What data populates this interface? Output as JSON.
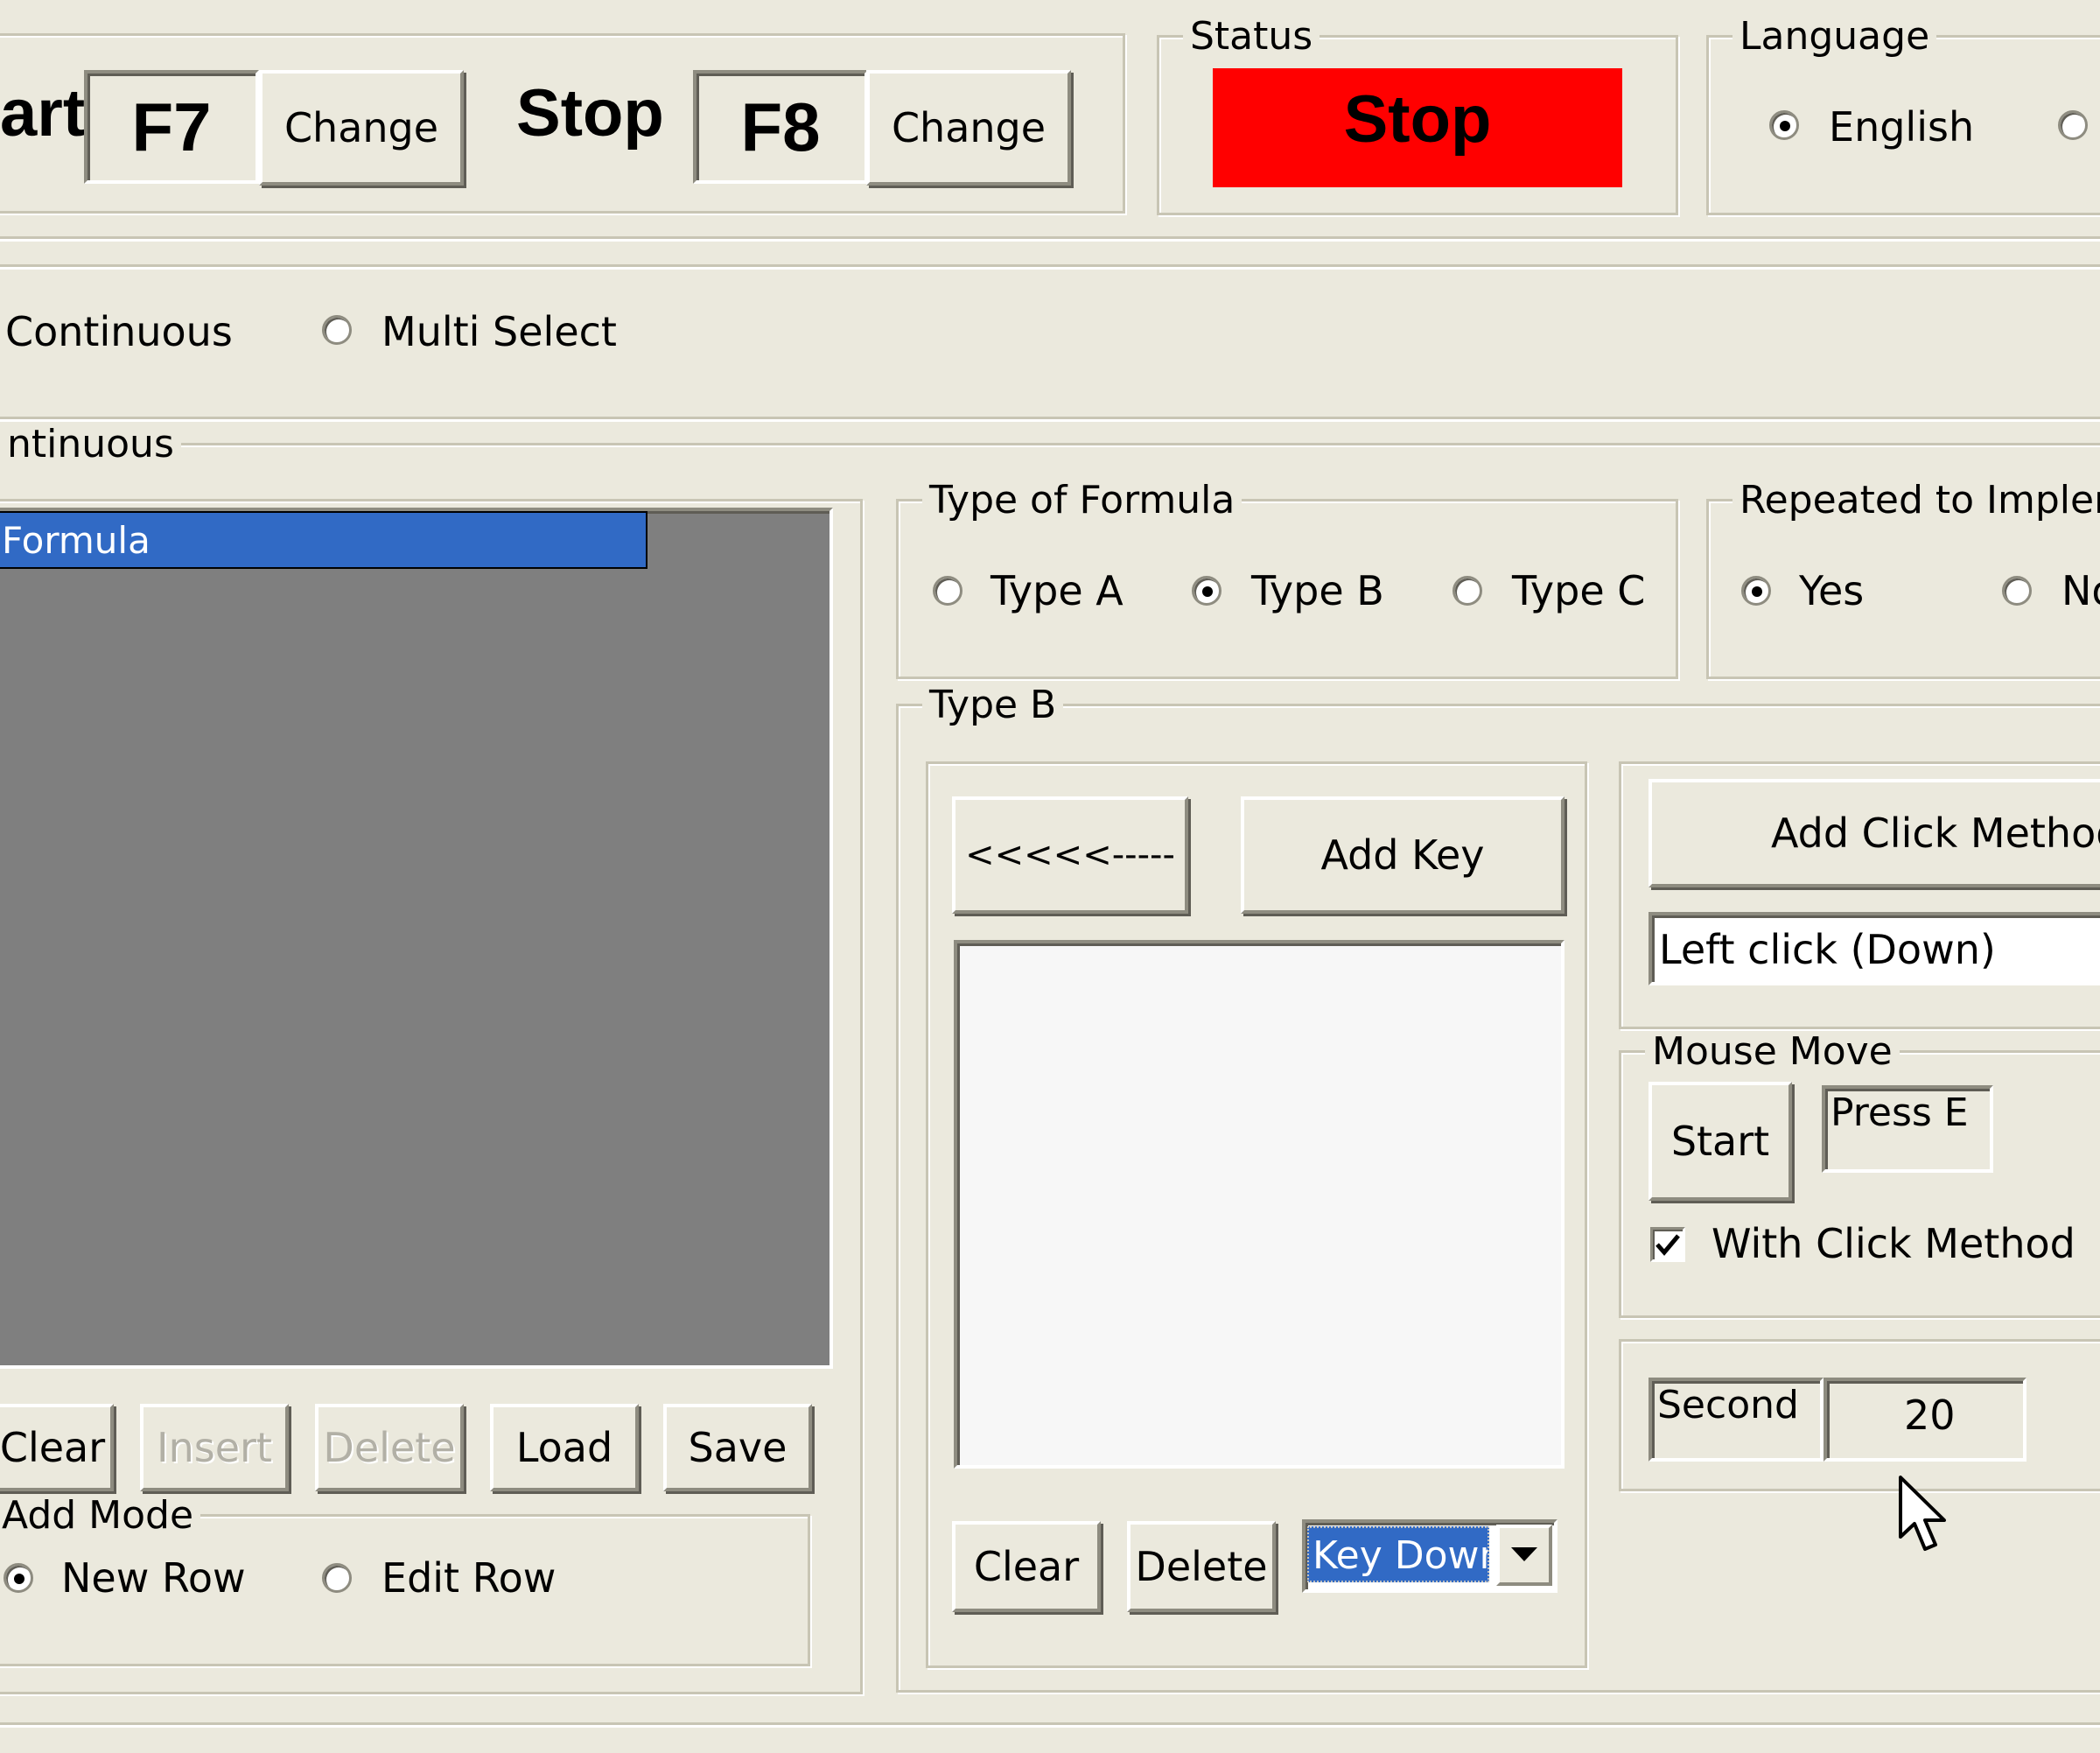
{
  "hotkeys": {
    "start_label": "art",
    "start_key": "F7",
    "start_change": "Change",
    "stop_label": "Stop",
    "stop_key": "F8",
    "stop_change": "Change"
  },
  "status": {
    "legend": "Status",
    "value": "Stop",
    "color": "#ff0000"
  },
  "language": {
    "legend": "Language",
    "options": [
      "English",
      ""
    ],
    "selected": "English"
  },
  "mode": {
    "options": [
      "Continuous",
      "Multi Select"
    ]
  },
  "continuous_group": {
    "legend": "ntinuous",
    "list_items": [
      "Formula"
    ],
    "selected_item": "Formula",
    "buttons": [
      "Clear",
      "Insert",
      "Delete",
      "Load",
      "Save"
    ],
    "disabled_buttons": [
      "Insert",
      "Delete"
    ]
  },
  "add_mode": {
    "legend": "Add Mode",
    "options": [
      "New Row",
      "Edit Row"
    ],
    "selected": "New Row"
  },
  "type_of_formula": {
    "legend": "Type of Formula",
    "options": [
      "Type A",
      "Type B",
      "Type C"
    ],
    "selected": "Type B"
  },
  "repeated": {
    "legend": "Repeated to Impleme",
    "options": [
      "Yes",
      "No"
    ],
    "selected": "Yes"
  },
  "type_b": {
    "legend": "Type B",
    "back_button": "<<<<<-----",
    "add_key_button": "Add Key",
    "clear_button": "Clear",
    "delete_button": "Delete",
    "key_action_value": "Key Down"
  },
  "click_method": {
    "add_button": "Add Click Method",
    "selected": "Left click (Down)"
  },
  "mouse_move": {
    "legend": "Mouse Move",
    "start_button": "Start",
    "hint": "Press E",
    "with_click_label": "With Click Method",
    "with_click_checked": true
  },
  "timer": {
    "label": "Second",
    "value": "20"
  },
  "icons": [
    "radio-icon",
    "checkbox-check-icon",
    "dropdown-arrow-icon",
    "mouse-cursor-icon"
  ]
}
